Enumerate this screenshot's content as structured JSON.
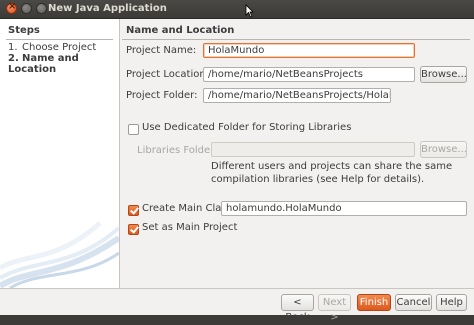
{
  "window": {
    "title": "New Java Application"
  },
  "steps": {
    "title": "Steps",
    "items": [
      {
        "num": "1.",
        "label": "Choose Project"
      },
      {
        "num": "2.",
        "label": "Name and Location"
      }
    ]
  },
  "form": {
    "section_title": "Name and Location",
    "project_name": {
      "label": "Project Name:",
      "value": "HolaMundo"
    },
    "project_location": {
      "label": "Project Location:",
      "value": "/home/mario/NetBeansProjects",
      "browse_label": "Browse..."
    },
    "project_folder": {
      "label": "Project Folder:",
      "value": "/home/mario/NetBeansProjects/HolaMundo"
    },
    "dedicated_folder": {
      "label": "Use Dedicated Folder for Storing Libraries",
      "checked": false
    },
    "libraries_folder": {
      "label": "Libraries Folder:",
      "value": "",
      "browse_label": "Browse..."
    },
    "info_text": "Different users and projects can share the same compilation libraries (see Help for details).",
    "create_main_class": {
      "label": "Create Main Class",
      "checked": true,
      "value": "holamundo.HolaMundo"
    },
    "set_main_project": {
      "label": "Set as Main Project",
      "checked": true
    }
  },
  "buttons": {
    "back": "< Back",
    "next": "Next >",
    "finish": "Finish",
    "cancel": "Cancel",
    "help": "Help"
  },
  "colors": {
    "accent": "#dd5a1d",
    "titlebar": "#3c3b37",
    "dialog_bg": "#f2f1f0"
  }
}
